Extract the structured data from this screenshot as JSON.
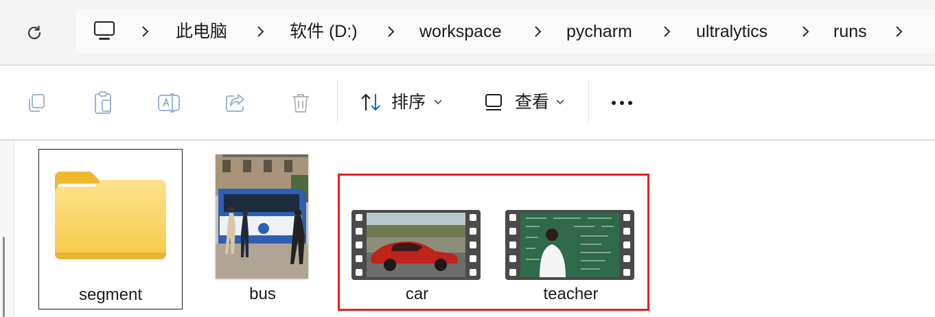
{
  "address_bar": {
    "breadcrumbs": [
      "此电脑",
      "软件 (D:)",
      "workspace",
      "pycharm",
      "ultralytics",
      "runs"
    ]
  },
  "toolbar": {
    "sort_label": "排序",
    "view_label": "查看"
  },
  "files": [
    {
      "name": "segment",
      "type": "folder",
      "selected": true
    },
    {
      "name": "bus",
      "type": "image"
    },
    {
      "name": "car",
      "type": "video",
      "highlighted": true
    },
    {
      "name": "teacher",
      "type": "video",
      "highlighted": true
    }
  ],
  "colors": {
    "highlight": "#e02020",
    "folder": "#f7c948",
    "accent": "#0067c0"
  }
}
